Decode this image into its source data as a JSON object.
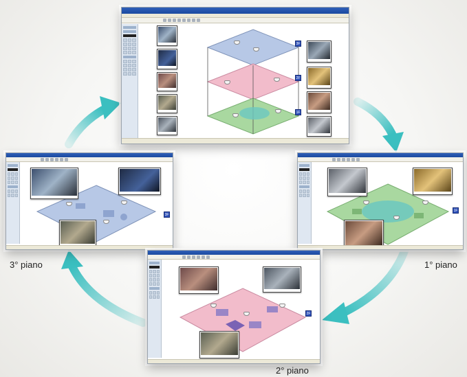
{
  "labels": {
    "floor3": "3° piano",
    "floor1": "1° piano",
    "floor2": "2° piano"
  },
  "windows": {
    "main": {
      "floor_buttons": [
        "3F",
        "2F",
        "1F"
      ]
    },
    "floor3": {
      "floor_button": "3F"
    },
    "floor1": {
      "floor_button": "1F"
    },
    "floor2": {
      "floor_button": "2F"
    }
  },
  "colors": {
    "arrow": "#3bbfc0",
    "floor3_map": "#b7c8e6",
    "floor2_map": "#f2bccb",
    "floor1_map": "#a9d8a0",
    "floor_button": "#2d50b8"
  }
}
